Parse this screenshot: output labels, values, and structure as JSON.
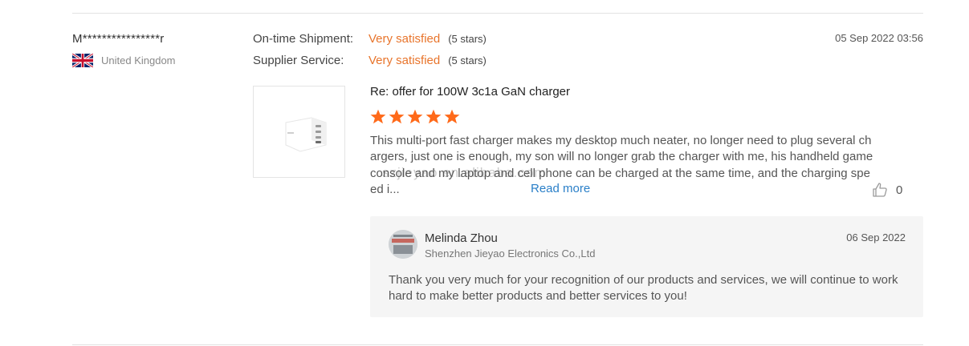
{
  "buyer": {
    "name": "M****************r",
    "country": "United Kingdom"
  },
  "ratings": [
    {
      "label": "On-time Shipment:",
      "value": "Very satisfied",
      "stars": "(5 stars)"
    },
    {
      "label": "Supplier Service:",
      "value": "Very satisfied",
      "stars": "(5 stars)"
    }
  ],
  "review": {
    "date": "05 Sep 2022 03:56",
    "title": "Re: offer for 100W 3c1a GaN charger",
    "star_rating": 5,
    "text": "This multi-port fast charger makes my desktop much neater, no longer need to plug several chargers, just one is enough, my son will no longer grab the charger with me, his handheld game console and my laptop and cell phone can be charged at the same time, and the charging speed i...",
    "read_more": "Read more",
    "watermark": "szjieyao.en.alibaba.com",
    "likes": "0"
  },
  "reply": {
    "name": "Melinda Zhou",
    "company": "Shenzhen Jieyao Electronics Co.,Ltd",
    "date": "06 Sep 2022",
    "text": "Thank you very much for your recognition of our products and services, we will continue to work hard to make better products and better services to you!"
  },
  "colors": {
    "accent": "#e8742b",
    "star": "#ff6a1a",
    "link": "#2a7fc8",
    "reply_bg": "#f5f5f5"
  },
  "icons": {
    "flag": "uk-flag-icon",
    "star": "star-icon",
    "like": "thumbs-up-icon"
  }
}
